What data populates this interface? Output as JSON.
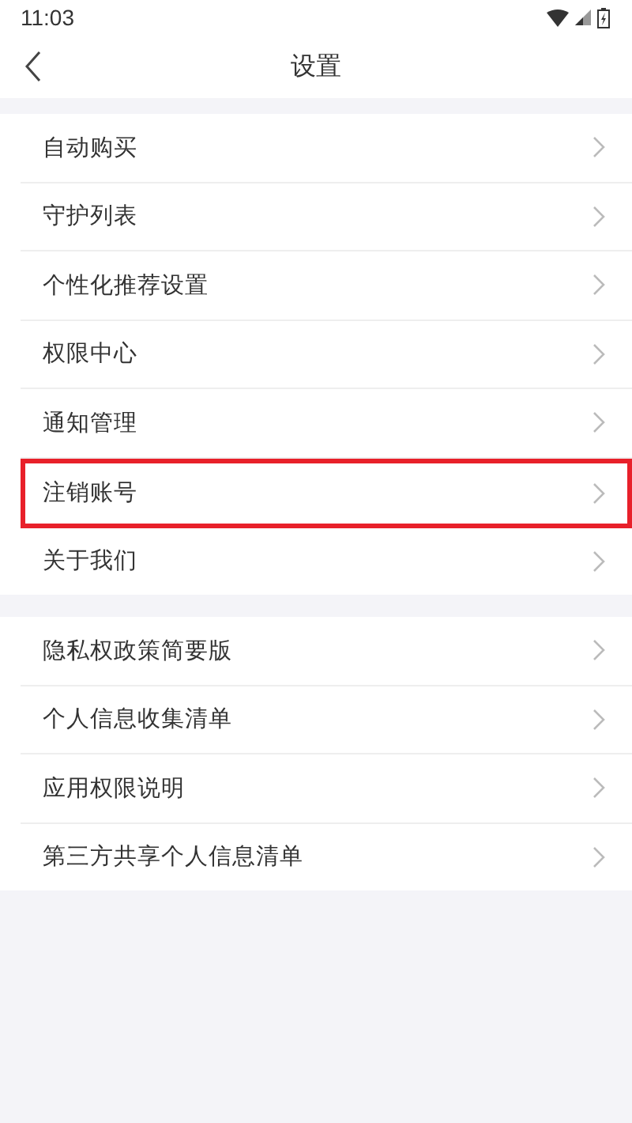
{
  "status_bar": {
    "time": "11:03"
  },
  "header": {
    "title": "设置"
  },
  "groups": [
    {
      "items": [
        {
          "label": "自动购买",
          "highlighted": false
        },
        {
          "label": "守护列表",
          "highlighted": false
        },
        {
          "label": "个性化推荐设置",
          "highlighted": false
        },
        {
          "label": "权限中心",
          "highlighted": false
        },
        {
          "label": "通知管理",
          "highlighted": false
        },
        {
          "label": "注销账号",
          "highlighted": true
        },
        {
          "label": "关于我们",
          "highlighted": false
        }
      ]
    },
    {
      "items": [
        {
          "label": "隐私权政策简要版",
          "highlighted": false
        },
        {
          "label": "个人信息收集清单",
          "highlighted": false
        },
        {
          "label": "应用权限说明",
          "highlighted": false
        },
        {
          "label": "第三方共享个人信息清单",
          "highlighted": false
        }
      ]
    }
  ]
}
